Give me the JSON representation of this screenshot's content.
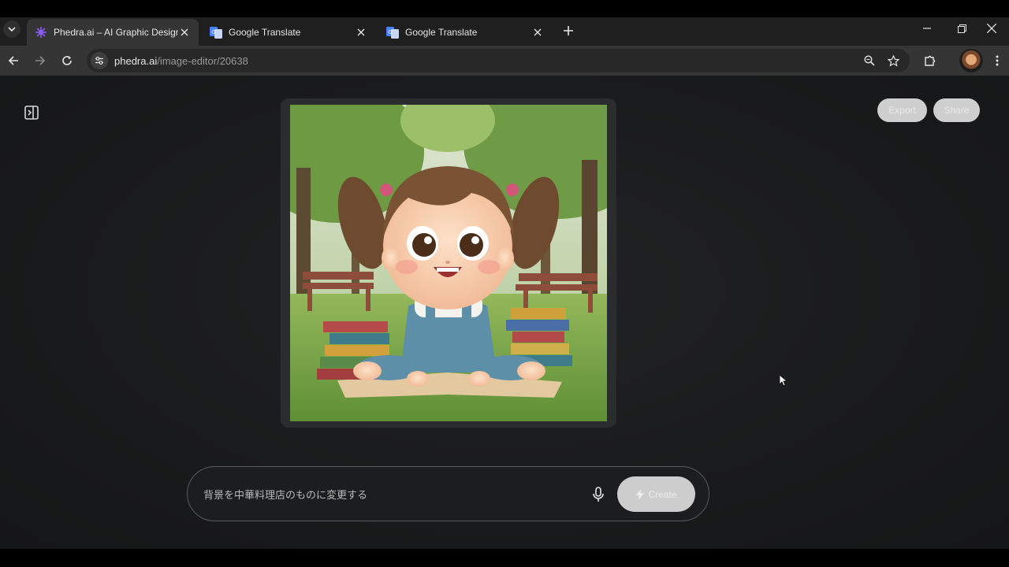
{
  "browser": {
    "tabs": [
      {
        "title": "Phedra.ai – AI Graphic Designer",
        "active": true,
        "favicon": "phedra-logo-icon"
      },
      {
        "title": "Google Translate",
        "active": false,
        "favicon": "google-translate-icon"
      },
      {
        "title": "Google Translate",
        "active": false,
        "favicon": "google-translate-icon"
      }
    ],
    "url_host": "phedra.ai",
    "url_path": "/image-editor/20638"
  },
  "header": {
    "export_label": "Export",
    "share_label": "Share"
  },
  "prompt": {
    "value": "背景を中華料理店のものに変更する",
    "create_label": "Create"
  },
  "colors": {
    "page_bg": "#1a1b1c",
    "button_bg": "#cfcfcf",
    "accent_phedra": "#8b5cf6",
    "translate_blue": "#4285f4"
  }
}
